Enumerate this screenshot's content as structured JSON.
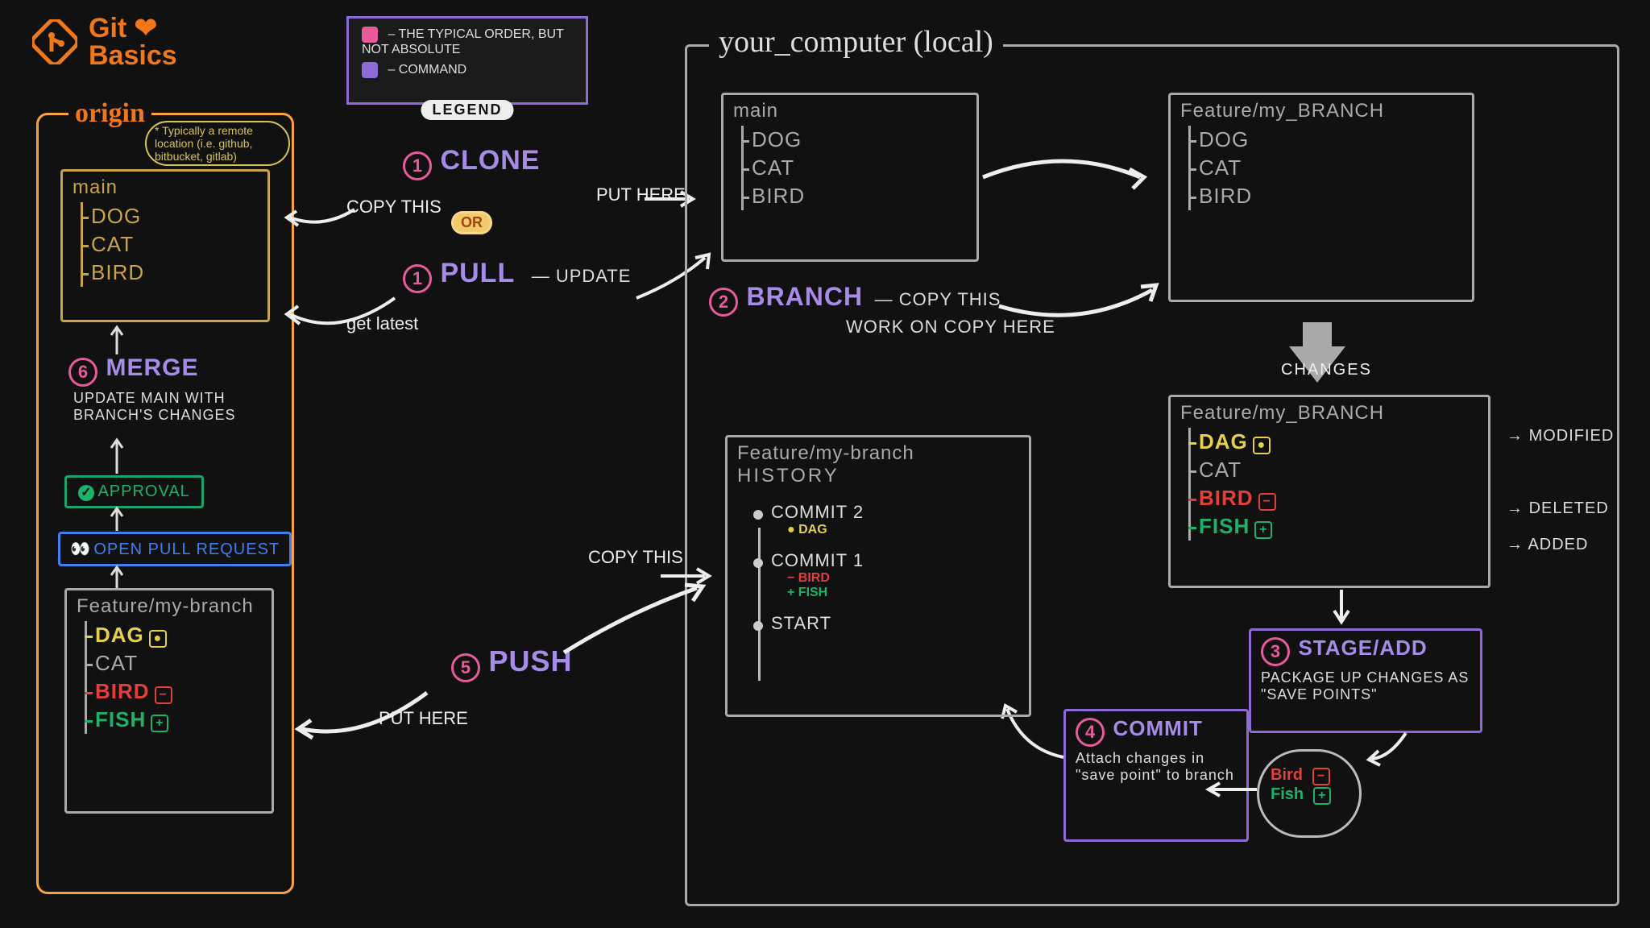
{
  "title": {
    "line1": "Git",
    "line2": "Basics",
    "heart": "❤"
  },
  "legend": {
    "label": "LEGEND",
    "item_pink": "THE TYPICAL ORDER, BUT NOT ABSOLUTE",
    "item_purple": "COMMAND"
  },
  "origin": {
    "heading": "origin",
    "note": "* Typically a remote location (i.e. github, bitbucket, gitlab)",
    "main_label": "main",
    "main_files": [
      "DOG",
      "CAT",
      "BIRD"
    ],
    "merge_step": "6",
    "merge_cmd": "MERGE",
    "merge_note": "UPDATE MAIN WITH BRANCH'S CHANGES",
    "approval": "APPROVAL",
    "pull_request": "OPEN PULL REQUEST",
    "feature_label": "Feature/my-branch",
    "feature_files": [
      {
        "name": "DAG",
        "kind": "yellow",
        "chip": "●"
      },
      {
        "name": "CAT",
        "kind": "grey"
      },
      {
        "name": "BIRD",
        "kind": "red",
        "chip": "−"
      },
      {
        "name": "FISH",
        "kind": "green",
        "chip": "+"
      }
    ]
  },
  "clone": {
    "step": "1",
    "cmd": "CLONE",
    "copy": "COPY THIS",
    "put": "PUT HERE"
  },
  "or": "OR",
  "pull": {
    "step": "1",
    "cmd": "PULL",
    "note": "UPDATE",
    "get": "get latest"
  },
  "local": {
    "heading": "your_computer (local)",
    "main_label": "main",
    "main_files": [
      "DOG",
      "CAT",
      "BIRD"
    ]
  },
  "branch": {
    "step": "2",
    "cmd": "BRANCH",
    "note1": "COPY THIS",
    "note2": "WORK ON COPY HERE",
    "feature_label": "Feature/my_BRANCH",
    "feature_files": [
      "DOG",
      "CAT",
      "BIRD"
    ]
  },
  "changes": {
    "arrow": "CHANGES",
    "feature_label": "Feature/my_BRANCH",
    "rows": [
      {
        "name": "DAG",
        "kind": "yellow",
        "chip": "●",
        "ann": "MODIFIED"
      },
      {
        "name": "CAT",
        "kind": "grey"
      },
      {
        "name": "BIRD",
        "kind": "red",
        "chip": "−",
        "ann": "DELETED"
      },
      {
        "name": "FISH",
        "kind": "green",
        "chip": "+",
        "ann": "ADDED"
      }
    ]
  },
  "stage": {
    "step": "3",
    "cmd": "STAGE/ADD",
    "note": "PACKAGE UP CHANGES AS \"SAVE POINTS\""
  },
  "savepoint": {
    "bird": "Bird",
    "fish": "Fish"
  },
  "commit": {
    "step": "4",
    "cmd": "COMMIT",
    "note": "Attach changes in \"save point\" to branch"
  },
  "history": {
    "title": "Feature/my-branch",
    "subtitle": "HISTORY",
    "items": [
      {
        "label": "COMMIT 2",
        "lines": [
          {
            "t": "● DAG",
            "c": "yellow"
          }
        ]
      },
      {
        "label": "COMMIT 1",
        "lines": [
          {
            "t": "− BIRD",
            "c": "red"
          },
          {
            "t": "+ FISH",
            "c": "green"
          }
        ]
      },
      {
        "label": "START",
        "lines": []
      }
    ]
  },
  "push": {
    "step": "5",
    "cmd": "PUSH",
    "copy": "COPY THIS",
    "put": "PUT HERE"
  }
}
